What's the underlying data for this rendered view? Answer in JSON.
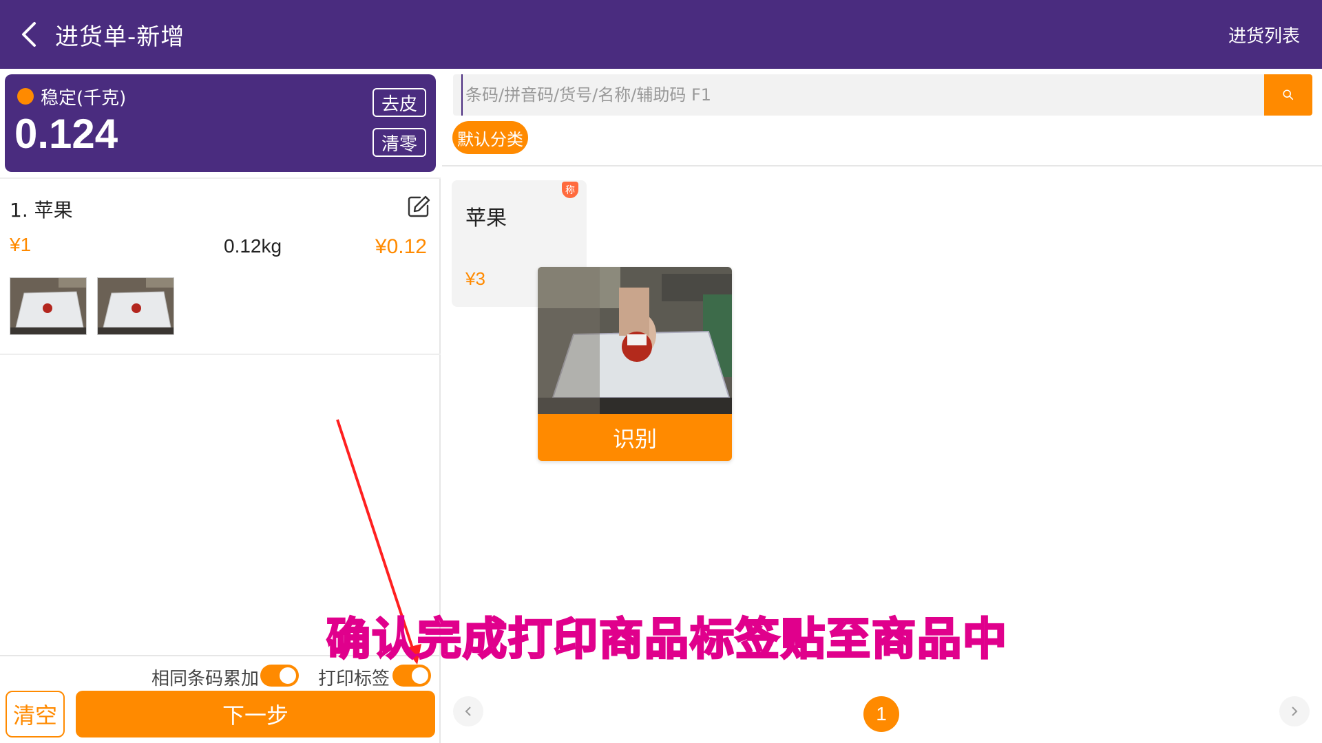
{
  "header": {
    "title": "进货单-新增",
    "list_link": "进货列表"
  },
  "scale": {
    "status": "稳定(千克)",
    "weight": "0.124",
    "tare_label": "去皮",
    "zero_label": "清零"
  },
  "order_items": [
    {
      "name": "1. 苹果",
      "price": "¥1",
      "weight": "0.12kg",
      "subtotal": "¥0.12"
    }
  ],
  "search": {
    "placeholder": "条码/拼音码/货号/名称/辅助码 F1"
  },
  "category": {
    "label": "默认分类"
  },
  "products": [
    {
      "name": "苹果",
      "price": "¥3",
      "badge": "称"
    }
  ],
  "camera": {
    "recognize_label": "识别"
  },
  "footer": {
    "accumulate_label": "相同条码累加",
    "print_label": "打印标签",
    "accumulate_on": true,
    "print_on": true,
    "clear_label": "清空",
    "next_label": "下一步"
  },
  "pager": {
    "current": "1"
  },
  "caption": "确认完成打印商品标签贴至商品中",
  "colors": {
    "header": "#4a2c7f",
    "accent": "#ff8a00",
    "caption_stroke": "#e0008c"
  }
}
